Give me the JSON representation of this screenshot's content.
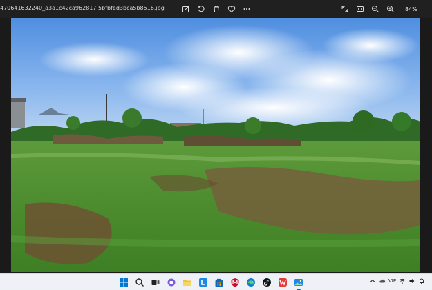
{
  "window": {
    "filename": "470641632240_a3a1c42ca962817 5bfbfed3bca5b8516.jpg",
    "zoom": "84%"
  },
  "toolbar": {
    "left_icons": [
      "edit-icon",
      "rotate-icon",
      "delete-icon",
      "favorite-icon",
      "more-icon"
    ],
    "right_icons": [
      "fullscreen-icon",
      "fit-icon",
      "zoom-out-icon",
      "zoom-in-icon"
    ]
  },
  "taskbar": {
    "apps": [
      "start-icon",
      "search-icon",
      "task-view-icon",
      "chat-icon",
      "file-explorer-icon",
      "l-app-icon",
      "store-icon",
      "mcafee-icon",
      "edge-icon",
      "tiktok-icon",
      "wps-icon",
      "photos-icon"
    ],
    "tray": {
      "language": "VIE"
    }
  },
  "colors": {
    "titlebar": "#202020",
    "taskbar": "#eef2f6",
    "accent": "#0067c0"
  }
}
